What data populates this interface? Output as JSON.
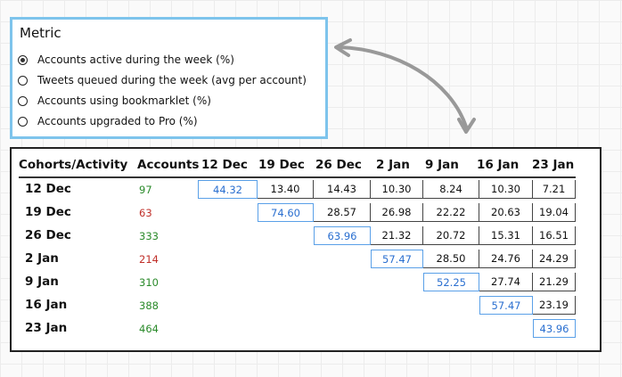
{
  "metric": {
    "title": "Metric",
    "options": [
      {
        "label": "Accounts active during the week (%)",
        "selected": true
      },
      {
        "label": "Tweets queued during the week (avg per account)",
        "selected": false
      },
      {
        "label": "Accounts using bookmarklet (%)",
        "selected": false
      },
      {
        "label": "Accounts upgraded to Pro (%)",
        "selected": false
      }
    ]
  },
  "table": {
    "corner_header": "Cohorts/Activity",
    "accounts_header": "Accounts",
    "columns": [
      "12 Dec",
      "19 Dec",
      "26 Dec",
      "2 Jan",
      "9 Jan",
      "16 Jan",
      "23 Jan"
    ],
    "rows": [
      {
        "cohort": "12 Dec",
        "accounts": "97",
        "accounts_color": "#2a8a2a",
        "values": [
          "44.32",
          "13.40",
          "14.43",
          "10.30",
          "8.24",
          "10.30",
          "7.21"
        ]
      },
      {
        "cohort": "19 Dec",
        "accounts": "63",
        "accounts_color": "#c0302a",
        "values": [
          "",
          "74.60",
          "28.57",
          "26.98",
          "22.22",
          "20.63",
          "19.04"
        ]
      },
      {
        "cohort": "26 Dec",
        "accounts": "333",
        "accounts_color": "#2a8a2a",
        "values": [
          "",
          "",
          "63.96",
          "21.32",
          "20.72",
          "15.31",
          "16.51"
        ]
      },
      {
        "cohort": "2 Jan",
        "accounts": "214",
        "accounts_color": "#c0302a",
        "values": [
          "",
          "",
          "",
          "57.47",
          "28.50",
          "24.76",
          "24.29"
        ]
      },
      {
        "cohort": "9 Jan",
        "accounts": "310",
        "accounts_color": "#2a8a2a",
        "values": [
          "",
          "",
          "",
          "",
          "52.25",
          "27.74",
          "21.29"
        ]
      },
      {
        "cohort": "16 Jan",
        "accounts": "388",
        "accounts_color": "#2a8a2a",
        "values": [
          "",
          "",
          "",
          "",
          "",
          "57.47",
          "23.19"
        ]
      },
      {
        "cohort": "23 Jan",
        "accounts": "464",
        "accounts_color": "#2a8a2a",
        "values": [
          "",
          "",
          "",
          "",
          "",
          "",
          "43.96"
        ]
      }
    ]
  },
  "colors": {
    "panel_border": "#7ec4ec",
    "diagonal_text": "#2a6fd0",
    "arrow": "#999999"
  }
}
